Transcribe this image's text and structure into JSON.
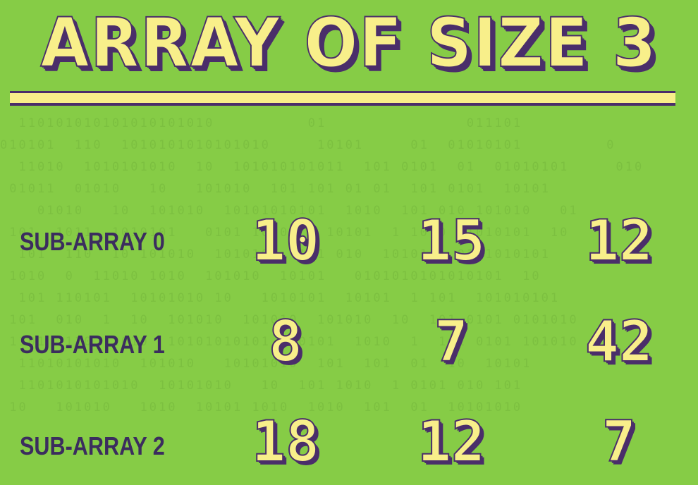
{
  "title": "ARRAY OF SIZE 3",
  "rows": [
    {
      "label": "SUB-ARRAY 0",
      "values": [
        "10",
        "15",
        "12"
      ]
    },
    {
      "label": "SUB-ARRAY 1",
      "values": [
        "8",
        "7",
        "42"
      ]
    },
    {
      "label": "SUB-ARRAY 2",
      "values": [
        "18",
        "12",
        "7"
      ]
    }
  ],
  "colors": {
    "background": "#86cc46",
    "text_fill": "#f8ef8a",
    "outline": "#4a2e6a",
    "label": "#3b2d5e"
  }
}
